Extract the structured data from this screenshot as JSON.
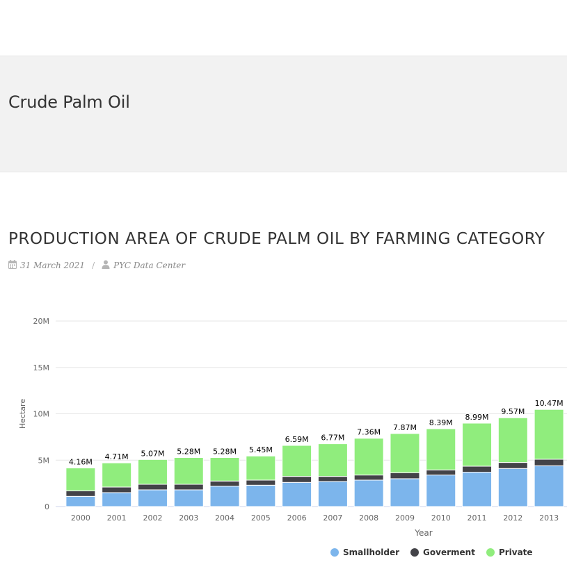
{
  "page": {
    "title": "Crude Palm Oil",
    "post_title": "PRODUCTION AREA OF CRUDE PALM OIL BY FARMING CATEGORY",
    "date": "31 March 2021",
    "separator": "/",
    "author": "PYC Data Center",
    "icons": {
      "date": "calendar-icon",
      "author": "user-icon"
    }
  },
  "colors": {
    "smallholder": "#7cb5ec",
    "goverment": "#434348",
    "private": "#90ed7d"
  },
  "chart_data": {
    "type": "bar",
    "stacked": true,
    "xlabel": "Year",
    "ylabel": "Hectare",
    "ylim": [
      0,
      20000000
    ],
    "y_ticks": [
      "0",
      "5M",
      "10M",
      "15M",
      "20M"
    ],
    "grid": true,
    "legend_position": "bottom-right",
    "categories": [
      "2000",
      "2001",
      "2002",
      "2003",
      "2004",
      "2005",
      "2006",
      "2007",
      "2008",
      "2009",
      "2010",
      "2011",
      "2012",
      "2013"
    ],
    "series": [
      {
        "name": "Smallholder",
        "values": [
          1100000,
          1500000,
          1800000,
          1800000,
          2200000,
          2300000,
          2600000,
          2700000,
          2850000,
          3000000,
          3400000,
          3700000,
          4100000,
          4400000
        ]
      },
      {
        "name": "Goverment",
        "values": [
          600000,
          600000,
          600000,
          600000,
          550000,
          550000,
          650000,
          550000,
          550000,
          650000,
          550000,
          650000,
          650000,
          700000
        ]
      },
      {
        "name": "Private",
        "values": [
          2460000,
          2610000,
          2670000,
          2880000,
          2530000,
          2600000,
          3340000,
          3520000,
          3960000,
          4220000,
          4440000,
          4640000,
          4820000,
          5370000
        ]
      }
    ],
    "total_labels": [
      "4.16M",
      "4.71M",
      "5.07M",
      "5.28M",
      "5.28M",
      "5.45M",
      "6.59M",
      "6.77M",
      "7.36M",
      "7.87M",
      "8.39M",
      "8.99M",
      "9.57M",
      "10.47M"
    ]
  }
}
